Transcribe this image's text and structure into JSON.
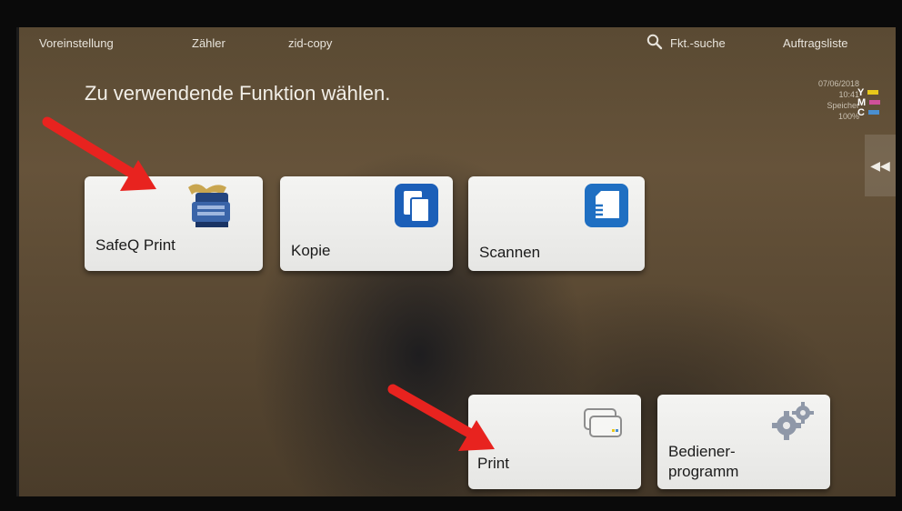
{
  "topbar": {
    "preset": "Voreinstellung",
    "counter": "Zähler",
    "user": "zid-copy",
    "search": "Fkt.-suche",
    "joblist": "Auftragsliste"
  },
  "title": "Zu verwendende Funktion wählen.",
  "status": {
    "date": "07/06/2018",
    "time": "10:41",
    "memory_label": "Speicher",
    "memory_value": "100%"
  },
  "toner": {
    "y": "Y",
    "m": "M",
    "c": "C",
    "colors": {
      "yellow": "#e8c81a",
      "magenta": "#d0509a",
      "cyan": "#4a8fd0"
    }
  },
  "side_tab": "◀◀",
  "tiles": {
    "safeq": {
      "label": "SafeQ Print",
      "icon": "printer-icon"
    },
    "kopie": {
      "label": "Kopie",
      "icon": "copy-icon"
    },
    "scannen": {
      "label": "Scannen",
      "icon": "scan-icon"
    },
    "print": {
      "label": "Print",
      "icon": "print-cards-icon"
    },
    "bediener": {
      "label_line1": "Bediener-",
      "label_line2": "programm",
      "icon": "gears-icon"
    }
  },
  "colors": {
    "arrow": "#e8231f",
    "accent_blue": "#1c5fb8"
  }
}
